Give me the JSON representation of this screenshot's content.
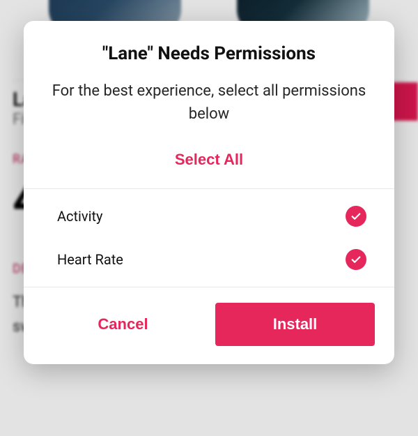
{
  "colors": {
    "accent": "#e5275b"
  },
  "background": {
    "app_name": "Lane",
    "app_subtitle": "Fitbit",
    "rating_label": "RATING",
    "description_label": "DESCRIPTION",
    "description_text": "The default view is your daily activity progress. You can switch to Core Stats by tapping on the screen."
  },
  "modal": {
    "title": "\"Lane\" Needs Permissions",
    "subtitle": "For the best experience, select all permissions below",
    "select_all_label": "Select All",
    "permissions": [
      {
        "label": "Activity",
        "checked": true
      },
      {
        "label": "Heart Rate",
        "checked": true
      }
    ],
    "cancel_label": "Cancel",
    "install_label": "Install"
  }
}
